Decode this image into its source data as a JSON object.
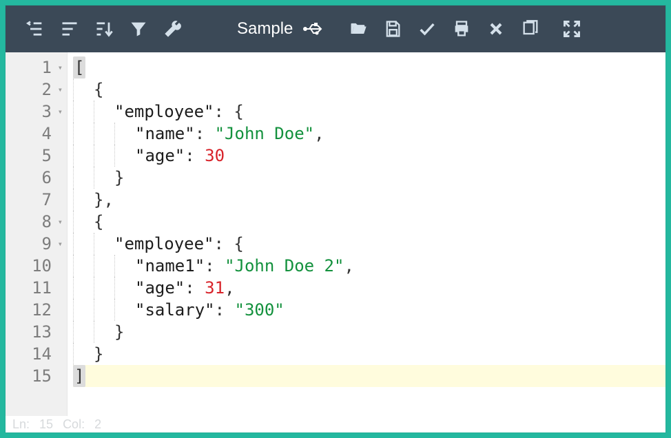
{
  "toolbar": {
    "sample_label": "Sample"
  },
  "editor": {
    "lines": [
      {
        "n": 1,
        "fold": true,
        "hl": false,
        "indent": 0,
        "tokens": [
          {
            "c": "bracket-hl",
            "t": "["
          }
        ]
      },
      {
        "n": 2,
        "fold": true,
        "hl": false,
        "indent": 1,
        "tokens": [
          {
            "c": "pun",
            "t": "{"
          }
        ]
      },
      {
        "n": 3,
        "fold": true,
        "hl": false,
        "indent": 2,
        "tokens": [
          {
            "c": "key",
            "t": "\"employee\""
          },
          {
            "c": "colon",
            "t": ": "
          },
          {
            "c": "pun",
            "t": "{"
          }
        ]
      },
      {
        "n": 4,
        "fold": false,
        "hl": false,
        "indent": 3,
        "tokens": [
          {
            "c": "key",
            "t": "\"name\""
          },
          {
            "c": "colon",
            "t": ": "
          },
          {
            "c": "str",
            "t": "\"John Doe\""
          },
          {
            "c": "pun",
            "t": ","
          }
        ]
      },
      {
        "n": 5,
        "fold": false,
        "hl": false,
        "indent": 3,
        "tokens": [
          {
            "c": "key",
            "t": "\"age\""
          },
          {
            "c": "colon",
            "t": ": "
          },
          {
            "c": "num",
            "t": "30"
          }
        ]
      },
      {
        "n": 6,
        "fold": false,
        "hl": false,
        "indent": 2,
        "tokens": [
          {
            "c": "pun",
            "t": "}"
          }
        ]
      },
      {
        "n": 7,
        "fold": false,
        "hl": false,
        "indent": 1,
        "tokens": [
          {
            "c": "pun",
            "t": "},"
          }
        ]
      },
      {
        "n": 8,
        "fold": true,
        "hl": false,
        "indent": 1,
        "tokens": [
          {
            "c": "pun",
            "t": "{"
          }
        ]
      },
      {
        "n": 9,
        "fold": true,
        "hl": false,
        "indent": 2,
        "tokens": [
          {
            "c": "key",
            "t": "\"employee\""
          },
          {
            "c": "colon",
            "t": ": "
          },
          {
            "c": "pun",
            "t": "{"
          }
        ]
      },
      {
        "n": 10,
        "fold": false,
        "hl": false,
        "indent": 3,
        "tokens": [
          {
            "c": "key",
            "t": "\"name1\""
          },
          {
            "c": "colon",
            "t": ": "
          },
          {
            "c": "str",
            "t": "\"John Doe 2\""
          },
          {
            "c": "pun",
            "t": ","
          }
        ]
      },
      {
        "n": 11,
        "fold": false,
        "hl": false,
        "indent": 3,
        "tokens": [
          {
            "c": "key",
            "t": "\"age\""
          },
          {
            "c": "colon",
            "t": ": "
          },
          {
            "c": "num",
            "t": "31"
          },
          {
            "c": "pun",
            "t": ","
          }
        ]
      },
      {
        "n": 12,
        "fold": false,
        "hl": false,
        "indent": 3,
        "tokens": [
          {
            "c": "key",
            "t": "\"salary\""
          },
          {
            "c": "colon",
            "t": ": "
          },
          {
            "c": "str",
            "t": "\"300\""
          }
        ]
      },
      {
        "n": 13,
        "fold": false,
        "hl": false,
        "indent": 2,
        "tokens": [
          {
            "c": "pun",
            "t": "}"
          }
        ]
      },
      {
        "n": 14,
        "fold": false,
        "hl": false,
        "indent": 1,
        "tokens": [
          {
            "c": "pun",
            "t": "}"
          }
        ]
      },
      {
        "n": 15,
        "fold": false,
        "hl": true,
        "indent": 0,
        "tokens": [
          {
            "c": "bracket-hl",
            "t": "]"
          }
        ]
      }
    ]
  },
  "status": {
    "ln_label": "Ln:",
    "ln": "15",
    "col_label": "Col:",
    "col": "2"
  }
}
